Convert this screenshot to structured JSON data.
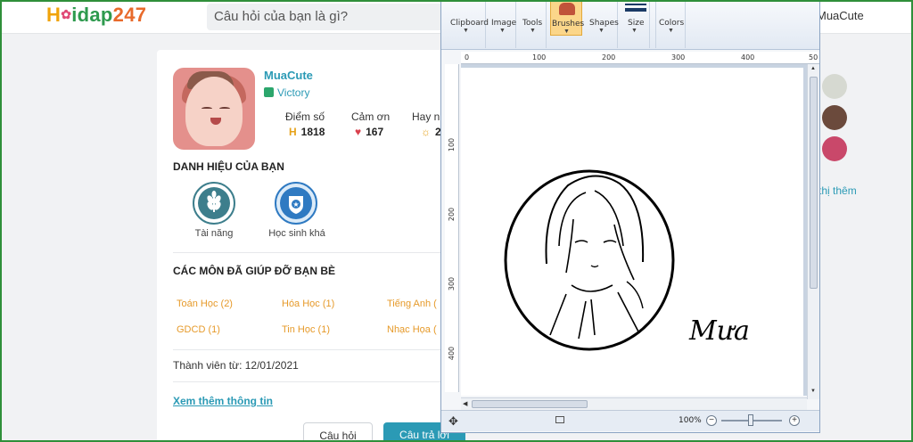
{
  "header": {
    "logo_text": "Hoidap247",
    "search_placeholder": "Câu hỏi của bạn là gì?",
    "user_name": "MuaCute"
  },
  "profile": {
    "username": "MuaCute",
    "rank": "Victory",
    "stats": [
      {
        "label": "Điểm số",
        "value": "1818",
        "icon": "points-icon"
      },
      {
        "label": "Cảm ơn",
        "value": "167",
        "icon": "heart-icon"
      },
      {
        "label": "Hay n",
        "value": "2",
        "icon": "medal-icon"
      }
    ],
    "titles_heading": "DANH HIỆU CỦA BẠN",
    "titles": [
      {
        "label": "Tài năng",
        "icon": "wheat-icon",
        "color": "#3d7e8c"
      },
      {
        "label": "Học sinh khá",
        "icon": "shield-star-icon",
        "color": "#2f7ac2"
      }
    ],
    "subjects_heading": "CÁC MÔN ĐÃ GIÚP ĐỠ BẠN BÈ",
    "subjects": [
      "Toán Học (2)",
      "Hóa Học (1)",
      "Tiếng Anh (",
      "GDCD (1)",
      "Tin Học (1)",
      "Nhạc Họa ("
    ],
    "member_since": "Thành viên từ: 12/01/2021",
    "more_info": "Xem thêm thông tin",
    "button_question": "Câu hỏi",
    "button_answer": "Câu trả lời"
  },
  "right_panel": {
    "show_more": "n thị thêm"
  },
  "paint": {
    "ribbon_groups": [
      "Clipboard",
      "Image",
      "Tools",
      "Brushes",
      "Shapes",
      "Size",
      "Colors"
    ],
    "ruler_top": [
      "0",
      "100",
      "200",
      "300",
      "400",
      "50"
    ],
    "ruler_left": [
      "100",
      "200",
      "300",
      "400"
    ],
    "signature": "Mưa",
    "zoom": "100%",
    "zoom_minus": "−",
    "zoom_plus": "+",
    "accent": "#fbd68a"
  }
}
